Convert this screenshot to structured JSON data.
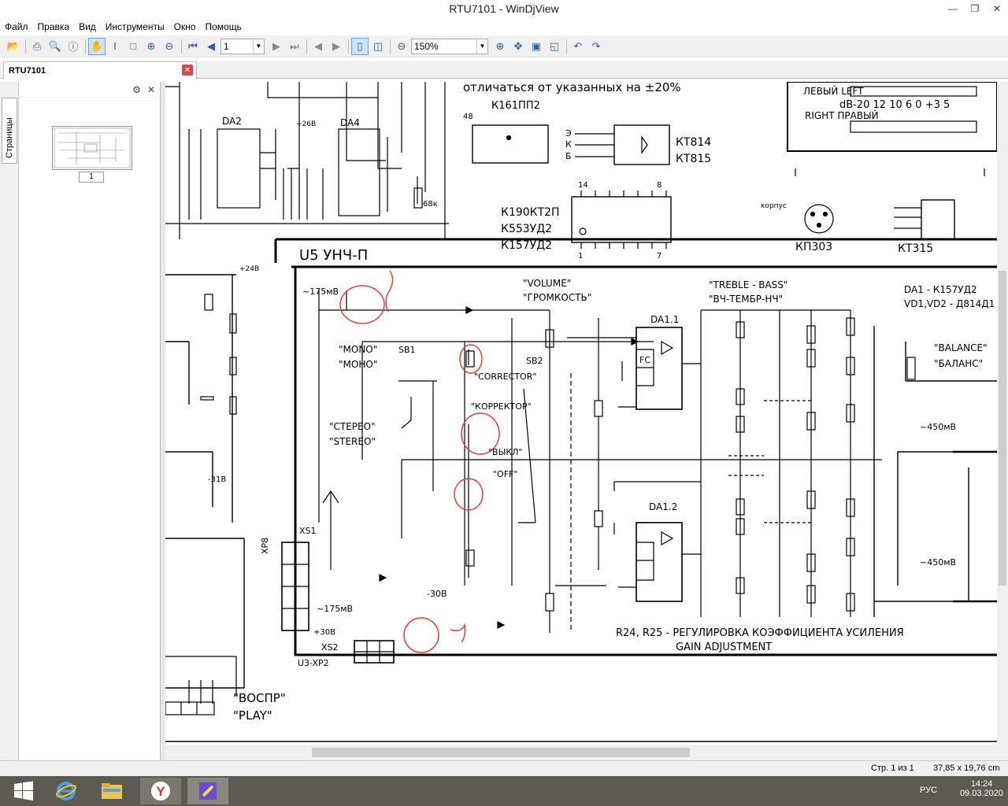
{
  "window": {
    "title": "RTU7101 - WinDjView"
  },
  "menu": [
    "Файл",
    "Правка",
    "Вид",
    "Инструменты",
    "Окно",
    "Помощь"
  ],
  "toolbar": {
    "page_value": "1",
    "zoom_value": "150%"
  },
  "tab": {
    "label": "RTU7101"
  },
  "sidebar": {
    "tab_label": "Страницы",
    "thumb_label": "1"
  },
  "status": {
    "page": "Стр. 1 из 1",
    "size": "37,85 x 19,76 cm"
  },
  "tray": {
    "lang": "РУС",
    "time": "14:24",
    "date": "09.03.2020"
  },
  "schematic": {
    "top_note": "отличаться от указанных на ±20%",
    "k161": "К161ПП2",
    "pin48": "48",
    "kt814": "КТ814",
    "kt815": "КТ815",
    "ekb": [
      "Э",
      "К",
      "Б"
    ],
    "ic14": "14",
    "ic8": "8",
    "ic1": "1",
    "ic7": "7",
    "k190": "К190КТ2П",
    "k553": "К553УД2",
    "k157": "К157УД2",
    "kp303": "КП303",
    "kt315": "КТ315",
    "korpus": "корпус",
    "left": "ЛЕВЫЙ LEFT",
    "right": "RIGHT ПРАВЫЙ",
    "db": "dB-20  12 10 6  0 +3 5",
    "u5": "U5  УНЧ-П",
    "volume": "\"VOLUME\"",
    "gromkost": "\"ГРОМКОСТЬ\"",
    "treble": "\"TREBLE - BASS\"",
    "vch": "\"ВЧ-ТЕМБР-НЧ\"",
    "da1": "DA1 - К157УД2",
    "vd": "VD1,VD2 - Д814Д1",
    "balance": "\"BALANCE\"",
    "balans": "\"БАЛАНС\"",
    "mono": "\"MONO\"",
    "mono_ru": "\"МОНО\"",
    "stereo_ru": "\"СТЕРЕО\"",
    "stereo": "\"STEREO\"",
    "corrector": "\"CORRECTOR\"",
    "korrektor": "\"КОРРЕКТОР\"",
    "vykl": "\"ВЫКЛ\"",
    "off": "\"OFF\"",
    "vospr": "\"ВОСПР\"",
    "play": "\"PLAY\"",
    "r24r25": "R24, R25 - РЕГУЛИРОВКА КОЭФФИЦИЕНТА УСИЛЕНИЯ",
    "gain": "GAIN ADJUSTMENT",
    "mv175": "~175мВ",
    "mv450": "~450мВ",
    "v308": "-30В",
    "v308p": "+30В",
    "v31": "-31В",
    "v24": "+24В",
    "v26": "+26В",
    "da2": "DA2",
    "da4": "DA4",
    "da11": "DA1.1",
    "da12": "DA1.2",
    "xs1": "XS1",
    "xs2": "XS2",
    "xp8": "XP8",
    "u3xp2": "U3-XP2",
    "sb1": "SB1",
    "sb2": "SB2",
    "r15_68k": "68к",
    "fc": "FC"
  },
  "colors": {
    "accent": "#2a5ea8",
    "annotation_red": "#e0403a",
    "taskbar": "#5d5a52"
  }
}
